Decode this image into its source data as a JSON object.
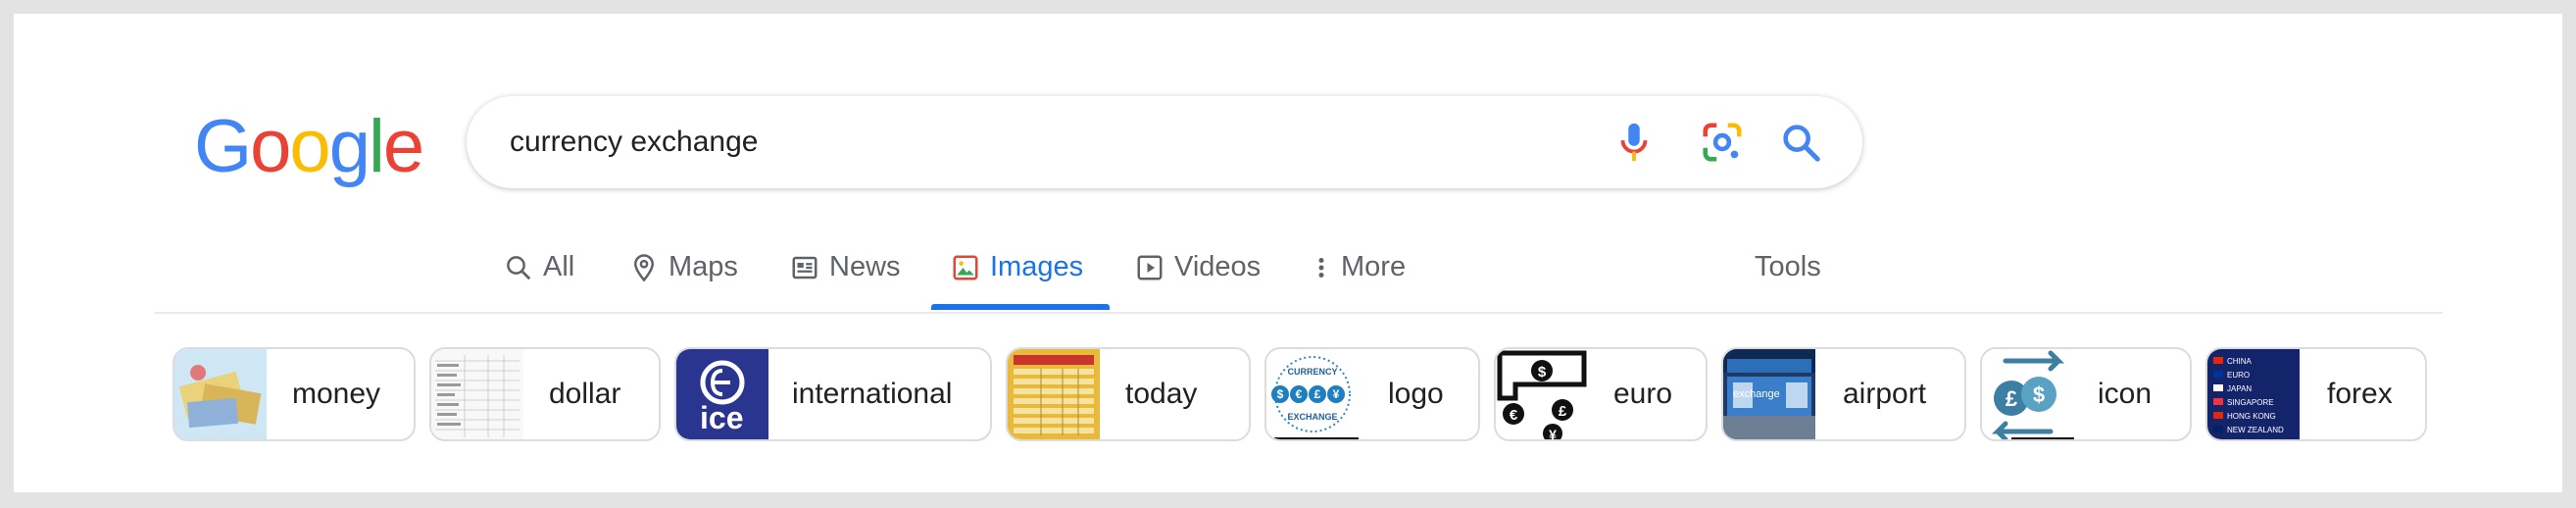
{
  "logo": {
    "letters": [
      "G",
      "o",
      "o",
      "g",
      "l",
      "e"
    ],
    "colors": [
      "#4285F4",
      "#EA4335",
      "#FBBC05",
      "#4285F4",
      "#34A853",
      "#EA4335"
    ]
  },
  "search": {
    "query": "currency exchange",
    "icons": [
      "microphone-icon",
      "lens-icon",
      "search-icon"
    ]
  },
  "tabs": [
    {
      "label": "All",
      "icon": "search-icon"
    },
    {
      "label": "Maps",
      "icon": "map-pin-icon"
    },
    {
      "label": "News",
      "icon": "news-icon"
    },
    {
      "label": "Images",
      "icon": "image-icon",
      "active": true
    },
    {
      "label": "Videos",
      "icon": "play-icon"
    },
    {
      "label": "More",
      "icon": "more-vert-icon"
    }
  ],
  "tools_label": "Tools",
  "chips": [
    {
      "label": "money"
    },
    {
      "label": "dollar"
    },
    {
      "label": "international",
      "thumb_text": "ice"
    },
    {
      "label": "today"
    },
    {
      "label": "logo",
      "thumb_text": [
        "CURRENCY",
        "EXCHANGE"
      ]
    },
    {
      "label": "euro"
    },
    {
      "label": "airport",
      "thumb_text": "exchange"
    },
    {
      "label": "icon"
    },
    {
      "label": "forex",
      "thumb_text": [
        "CHINA",
        "EURO",
        "JAPAN",
        "SINGAPORE",
        "HONG KONG",
        "NEW ZEALAND"
      ]
    }
  ],
  "colors": {
    "accent": "#1a73e8",
    "tab_text": "#5f6368",
    "chip_border": "#dadce0"
  }
}
